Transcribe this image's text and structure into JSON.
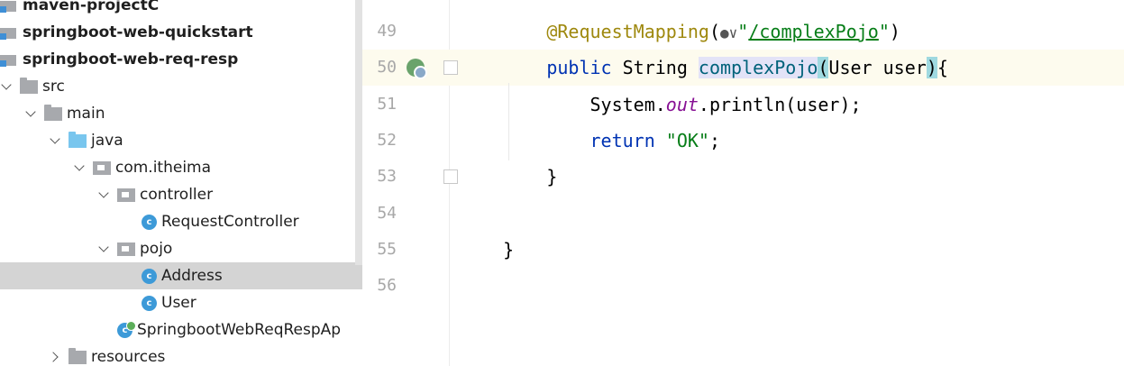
{
  "project_tree": {
    "items": [
      {
        "label": "maven-projectC",
        "depth": 0,
        "icon": "module-icon",
        "bold": true,
        "expanded": null,
        "selected": false
      },
      {
        "label": "springboot-web-quickstart",
        "depth": 0,
        "icon": "module-icon",
        "bold": true,
        "expanded": null,
        "selected": false
      },
      {
        "label": "springboot-web-req-resp",
        "depth": 0,
        "icon": "module-icon",
        "bold": true,
        "expanded": null,
        "selected": false
      },
      {
        "label": "src",
        "depth": 0,
        "icon": "folder-icon",
        "bold": false,
        "expanded": true,
        "selected": false
      },
      {
        "label": "main",
        "depth": 1,
        "icon": "folder-icon",
        "bold": false,
        "expanded": true,
        "selected": false
      },
      {
        "label": "java",
        "depth": 2,
        "icon": "source-folder-icon",
        "bold": false,
        "expanded": true,
        "selected": false
      },
      {
        "label": "com.itheima",
        "depth": 3,
        "icon": "package-icon",
        "bold": false,
        "expanded": true,
        "selected": false
      },
      {
        "label": "controller",
        "depth": 4,
        "icon": "package-icon",
        "bold": false,
        "expanded": true,
        "selected": false
      },
      {
        "label": "RequestController",
        "depth": 5,
        "icon": "class-icon",
        "bold": false,
        "expanded": null,
        "selected": false
      },
      {
        "label": "pojo",
        "depth": 4,
        "icon": "package-icon",
        "bold": false,
        "expanded": true,
        "selected": false
      },
      {
        "label": "Address",
        "depth": 5,
        "icon": "class-icon",
        "bold": false,
        "expanded": null,
        "selected": true
      },
      {
        "label": "User",
        "depth": 5,
        "icon": "class-icon",
        "bold": false,
        "expanded": null,
        "selected": false
      },
      {
        "label": "SpringbootWebReqRespAp",
        "depth": 4,
        "icon": "spring-app-class-icon",
        "bold": false,
        "expanded": null,
        "selected": false
      },
      {
        "label": "resources",
        "depth": 2,
        "icon": "folder-icon",
        "bold": false,
        "expanded": false,
        "selected": false
      }
    ],
    "class_badge": "c"
  },
  "editor": {
    "current_line": "50",
    "lines": [
      {
        "number": "49",
        "tokens": [
          {
            "text": "        "
          },
          {
            "text": "@RequestMapping",
            "cls": "ann"
          },
          {
            "text": "("
          },
          {
            "text": "●",
            "cls": "globe"
          },
          {
            "text": "∨",
            "cls": "globe"
          },
          {
            "text": "\"",
            "cls": "str"
          },
          {
            "text": "/complexPojo",
            "cls": "url"
          },
          {
            "text": "\"",
            "cls": "str"
          },
          {
            "text": ")"
          }
        ]
      },
      {
        "number": "50",
        "tokens": [
          {
            "text": "        "
          },
          {
            "text": "public",
            "cls": "kw"
          },
          {
            "text": " String "
          },
          {
            "text": "complexPojo",
            "cls": "method"
          },
          {
            "text": "(",
            "cls": "bracket"
          },
          {
            "text": "User user"
          },
          {
            "text": ")",
            "cls": "bracket"
          },
          {
            "text": "{"
          }
        ]
      },
      {
        "number": "51",
        "tokens": [
          {
            "text": "            System."
          },
          {
            "text": "out",
            "cls": "ital"
          },
          {
            "text": ".println(user);"
          }
        ]
      },
      {
        "number": "52",
        "tokens": [
          {
            "text": "            "
          },
          {
            "text": "return",
            "cls": "kw"
          },
          {
            "text": " "
          },
          {
            "text": "\"OK\"",
            "cls": "str"
          },
          {
            "text": ";"
          }
        ]
      },
      {
        "number": "53",
        "tokens": [
          {
            "text": "        }"
          }
        ]
      },
      {
        "number": "54",
        "tokens": []
      },
      {
        "number": "55",
        "tokens": [
          {
            "text": "    }"
          }
        ]
      },
      {
        "number": "56",
        "tokens": []
      }
    ]
  }
}
